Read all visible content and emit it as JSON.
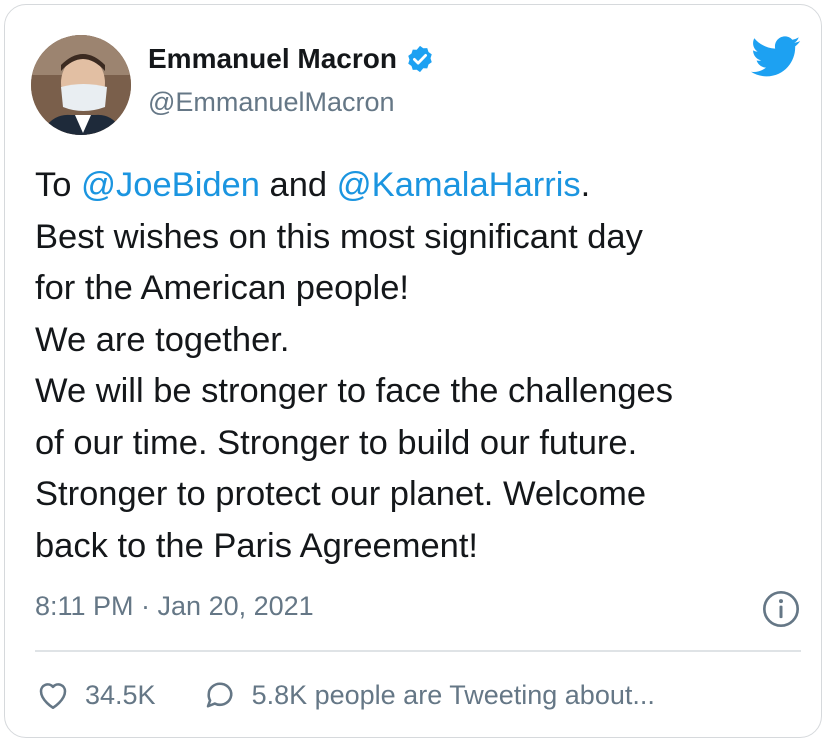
{
  "author": {
    "name": "Emmanuel Macron",
    "handle": "@EmmanuelMacron",
    "verified": true
  },
  "tweet": {
    "line1_prefix": "To ",
    "mention1": "@JoeBiden",
    "line1_middle": " and ",
    "mention2": "@KamalaHarris",
    "line1_suffix": ".",
    "lines": [
      "Best wishes on this most significant day",
      "for the American people!",
      "We are together.",
      "We will be stronger to face the challenges",
      "of our time. Stronger to build our future.",
      "Stronger to protect our planet. Welcome",
      "back to the Paris Agreement!"
    ]
  },
  "meta": {
    "timestamp": "8:11 PM · Jan 20, 2021"
  },
  "actions": {
    "likes": "34.5K",
    "conversation": "5.8K people are Tweeting about..."
  },
  "colors": {
    "accent": "#1da1f2",
    "mention": "#1b95e0",
    "secondary": "#657786"
  },
  "icons": [
    "verified-icon",
    "twitter-bird-icon",
    "info-icon",
    "heart-icon",
    "speech-bubble-icon"
  ]
}
